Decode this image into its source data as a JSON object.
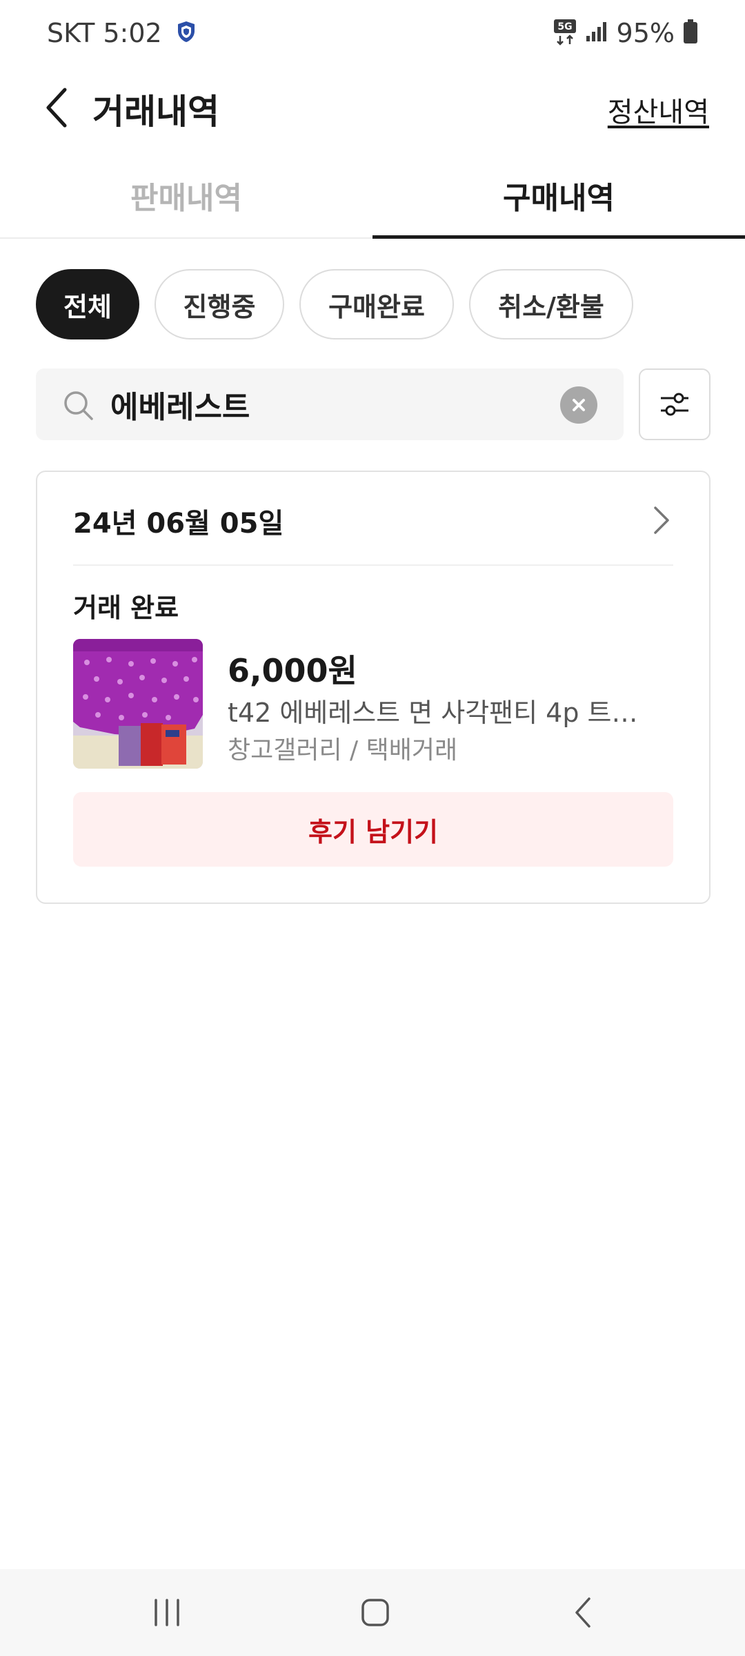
{
  "status_bar": {
    "carrier_time": "SKT 5:02",
    "network": "5G",
    "battery": "95%"
  },
  "header": {
    "title": "거래내역",
    "settle_link": "정산내역"
  },
  "tabs": [
    {
      "label": "판매내역",
      "active": false
    },
    {
      "label": "구매내역",
      "active": true
    }
  ],
  "filters": [
    {
      "label": "전체",
      "selected": true
    },
    {
      "label": "진행중",
      "selected": false
    },
    {
      "label": "구매완료",
      "selected": false
    },
    {
      "label": "취소/환불",
      "selected": false
    }
  ],
  "search": {
    "value": "에베레스트"
  },
  "order": {
    "date": "24년 06월 05일",
    "status": "거래 완료",
    "price": "6,000원",
    "product_name": "t42 에베레스트 면 사각팬티 4p 트렁...",
    "seller_info": "창고갤러리 / 택배거래",
    "review_button": "후기 남기기"
  },
  "colors": {
    "accent": "#c4111a",
    "review_bg": "#fff0f0",
    "chip_selected": "#1a1a1a"
  },
  "icons": {
    "back": "chevron-left-icon",
    "search": "search-icon",
    "clear": "clear-icon",
    "filter": "sliders-icon",
    "chevron": "chevron-right-icon"
  }
}
